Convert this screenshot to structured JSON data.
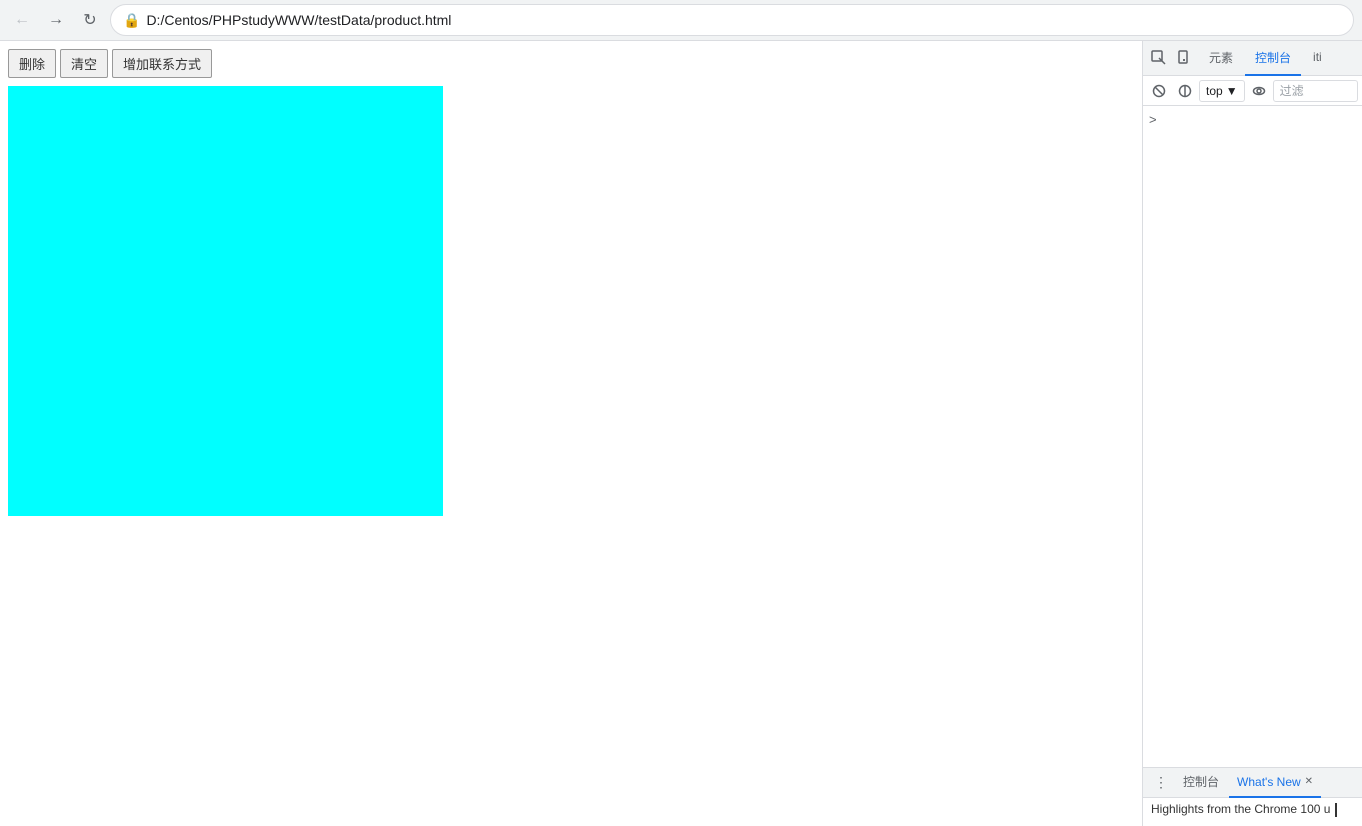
{
  "browser": {
    "address": "D:/Centos/PHPstudyWWW/testData/product.html",
    "back_title": "后退",
    "forward_title": "前进",
    "reload_title": "重新加载"
  },
  "page": {
    "buttons": [
      {
        "label": "删除"
      },
      {
        "label": "清空"
      },
      {
        "label": "增加联系方式"
      }
    ]
  },
  "devtools": {
    "tabs": [
      {
        "label": "元素"
      },
      {
        "label": "控制台"
      },
      {
        "label": "iti"
      }
    ],
    "active_tab": "控制台",
    "toolbar": {
      "dropdown_label": "top",
      "filter_placeholder": "过滤"
    },
    "body": {
      "chevron": ">"
    }
  },
  "bottom_drawer": {
    "menu_icon": "⋮",
    "tabs": [
      {
        "label": "控制台",
        "closable": false
      },
      {
        "label": "What's New",
        "closable": true
      }
    ],
    "active_tab": "What's New",
    "content": "Highlights from the Chrome 100 u"
  }
}
